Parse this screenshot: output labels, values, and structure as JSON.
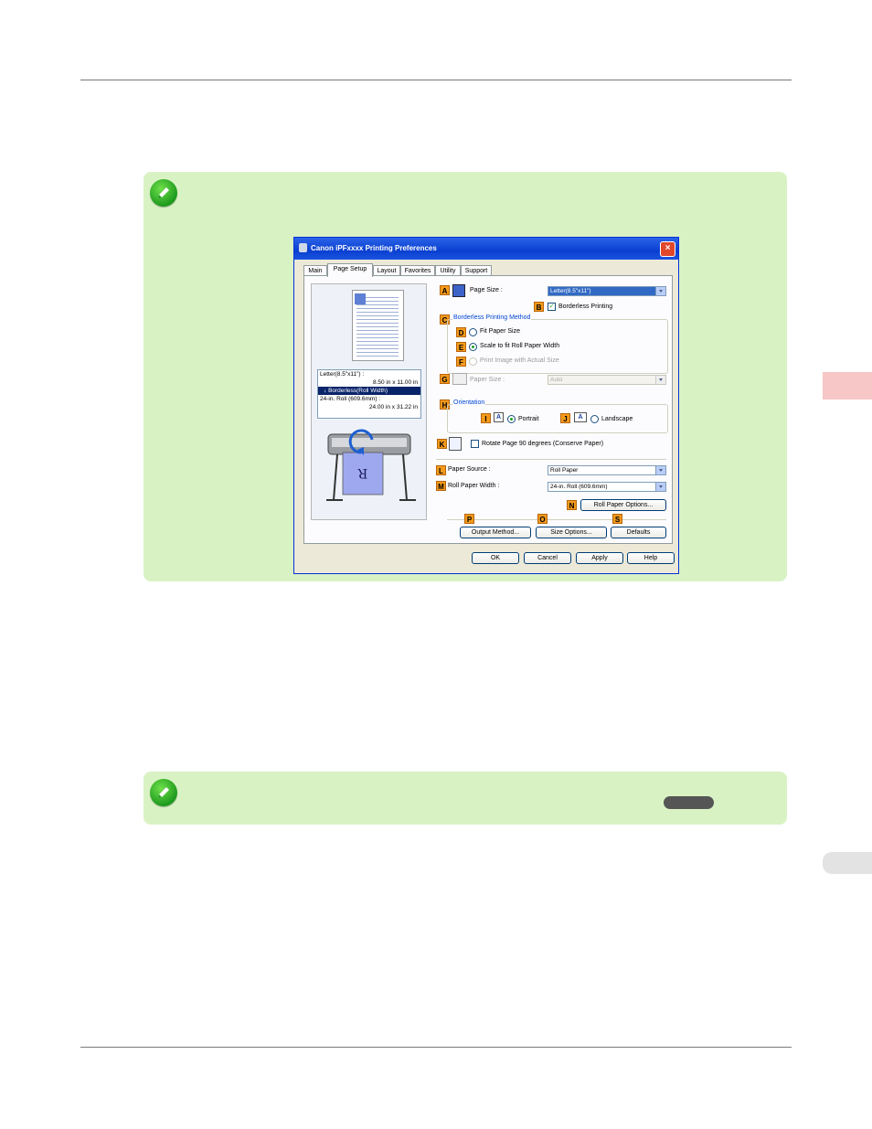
{
  "dialog": {
    "title": "Canon iPFxxxx Printing Preferences",
    "close": "×",
    "tabs": [
      "Main",
      "Page Setup",
      "Layout",
      "Favorites",
      "Utility",
      "Support"
    ],
    "markers": {
      "A": "A",
      "B": "B",
      "C": "C",
      "D": "D",
      "E": "E",
      "F": "F",
      "G": "G",
      "H": "H",
      "I": "I",
      "J": "J",
      "K": "K",
      "L": "L",
      "M": "M",
      "N": "N",
      "P": "P",
      "O": "O",
      "S": "S"
    },
    "preview": {
      "line1": "Letter(8.5\"x11\") :",
      "line2": "8.50 in x 11.00 in",
      "line3": "Borderless(Roll Width)",
      "line4": "24-in. Roll (609.6mm) :",
      "line5": "24.00 in x 31.22 in"
    },
    "page_size_label": "Page Size :",
    "page_size_value": "Letter(8.5\"x11\")",
    "borderless_label": "Borderless Printing",
    "borderless_method_label": "Borderless Printing Method",
    "fit_paper_size": "Fit Paper Size",
    "scale_to_fit": "Scale to fit Roll Paper Width",
    "print_actual_size": "Print Image with Actual Size",
    "paper_size_label": "Paper Size :",
    "paper_size_value": "Auto",
    "orientation_label": "Orientation",
    "portrait": "Portrait",
    "landscape": "Landscape",
    "orient_glyph": "A",
    "rotate_label": "Rotate Page 90 degrees (Conserve Paper)",
    "paper_source_label": "Paper Source :",
    "paper_source_value": "Roll Paper",
    "roll_width_label": "Roll Paper Width :",
    "roll_width_value": "24-in. Roll (609.6mm)",
    "roll_options_btn": "Roll Paper Options...",
    "output_method_btn": "Output Method...",
    "size_options_btn": "Size Options...",
    "defaults_btn": "Defaults",
    "ok": "OK",
    "cancel": "Cancel",
    "apply": "Apply",
    "help": "Help",
    "check_mark": "✓"
  }
}
